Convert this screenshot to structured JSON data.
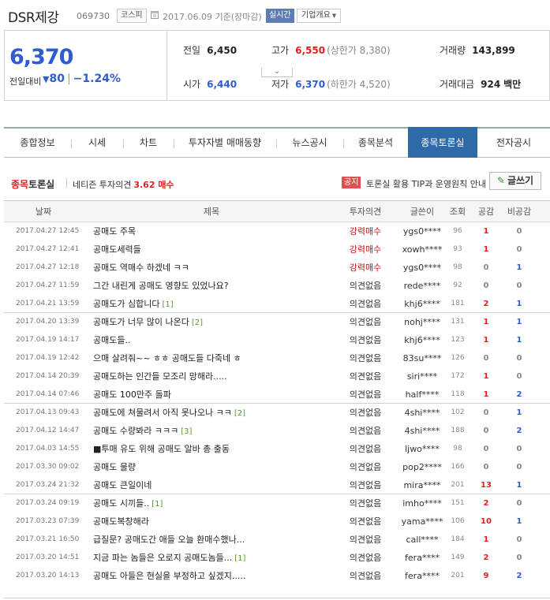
{
  "header": {
    "name": "DSR제강",
    "code": "069730",
    "market": "코스피",
    "date": "2017.06.09 기준(장마감)",
    "realtime": "실시간",
    "company_info": "기업개요"
  },
  "price": {
    "current": "6,370",
    "change_label": "전일대비",
    "change": "80",
    "change_pct": "−1.24%",
    "prev_close_label": "전일",
    "prev_close": "6,450",
    "high_label": "고가",
    "high": "6,550",
    "upper_limit": "(상한가 8,380)",
    "volume_label": "거래량",
    "volume": "143,899",
    "open_label": "시가",
    "open": "6,440",
    "low_label": "저가",
    "low": "6,370",
    "lower_limit": "(하한가 4,520)",
    "amount_label": "거래대금",
    "amount": "924",
    "amount_unit": "백만"
  },
  "tabs": [
    {
      "label": "종합정보"
    },
    {
      "label": "시세"
    },
    {
      "label": "차트"
    },
    {
      "label": "투자자별 매매동향"
    },
    {
      "label": "뉴스공시"
    },
    {
      "label": "종목분석"
    },
    {
      "label": "종목토론실",
      "active": true
    },
    {
      "label": "전자공시"
    }
  ],
  "board": {
    "title_red": "종목",
    "title_rest": "토론실",
    "opinion_label": "네티즌 투자의견",
    "opinion_value": "3.62 매수",
    "notice_badge": "공지",
    "notice_text": "토론실 활용 TIP과 운영원칙 안내",
    "write_button": "글쓰기",
    "columns": [
      "날짜",
      "제목",
      "투자의견",
      "글쓴이",
      "조회",
      "공감",
      "비공감"
    ]
  },
  "posts": [
    {
      "date": "2017.04.27 12:45",
      "title": "공매도 주목",
      "comments": "",
      "opinion": "강력매수",
      "writer": "ygs0****",
      "views": "96",
      "good": "1",
      "bad": "0"
    },
    {
      "date": "2017.04.27 12:41",
      "title": "공매도세력들",
      "comments": "",
      "opinion": "강력매수",
      "writer": "xowh****",
      "views": "93",
      "good": "1",
      "bad": "0"
    },
    {
      "date": "2017.04.27 12:18",
      "title": "공매도 역매수 하겠네 ㅋㅋ",
      "comments": "",
      "opinion": "강력매수",
      "writer": "ygs0****",
      "views": "98",
      "good": "0",
      "bad": "1"
    },
    {
      "date": "2017.04.27 11:59",
      "title": "그간 내린게 공매도 영향도 있었나요?",
      "comments": "",
      "opinion": "의견없음",
      "writer": "rede****",
      "views": "92",
      "good": "0",
      "bad": "0"
    },
    {
      "date": "2017.04.21 13:59",
      "title": "공매도가 심합니다",
      "comments": "[1]",
      "opinion": "의견없음",
      "writer": "khj6****",
      "views": "181",
      "good": "2",
      "bad": "1"
    },
    {
      "date": "2017.04.20 13:39",
      "title": "공매도가 너무 많이 나온다",
      "comments": "[2]",
      "opinion": "의견없음",
      "writer": "nohj****",
      "views": "131",
      "good": "1",
      "bad": "1"
    },
    {
      "date": "2017.04.19 14:17",
      "title": "공매도들..",
      "comments": "",
      "opinion": "의견없음",
      "writer": "khj6****",
      "views": "123",
      "good": "1",
      "bad": "1"
    },
    {
      "date": "2017.04.19 12:42",
      "title": "으매 살려줘~~ ㅎㅎ 공매도들 다죽네 ㅎ",
      "comments": "",
      "opinion": "의견없음",
      "writer": "83su****",
      "views": "126",
      "good": "0",
      "bad": "0"
    },
    {
      "date": "2017.04.14 20:39",
      "title": "공매도하는 인간들 모조리 망해라.....",
      "comments": "",
      "opinion": "의견없음",
      "writer": "siri****",
      "views": "172",
      "good": "1",
      "bad": "0"
    },
    {
      "date": "2017.04.14 07:46",
      "title": "공매도 100만주 돌파",
      "comments": "",
      "opinion": "의견없음",
      "writer": "half****",
      "views": "118",
      "good": "1",
      "bad": "2"
    },
    {
      "date": "2017.04.13 09:43",
      "title": "공매도에 쳐물려서 아직 못나오나 ㅋㅋ",
      "comments": "[2]",
      "opinion": "의견없음",
      "writer": "4shi****",
      "views": "102",
      "good": "0",
      "bad": "1"
    },
    {
      "date": "2017.04.12 14:47",
      "title": "공매도 수량봐라 ㅋㅋㅋ",
      "comments": "[3]",
      "opinion": "의견없음",
      "writer": "4shi****",
      "views": "188",
      "good": "0",
      "bad": "2"
    },
    {
      "date": "2017.04.03 14:55",
      "title": "■투매 유도 위해 공매도 알바 총 출동",
      "comments": "",
      "opinion": "의견없음",
      "writer": "ljwo****",
      "views": "98",
      "good": "0",
      "bad": "0"
    },
    {
      "date": "2017.03.30 09:02",
      "title": "공매도 물량",
      "comments": "",
      "opinion": "의견없음",
      "writer": "pop2****",
      "views": "166",
      "good": "0",
      "bad": "0"
    },
    {
      "date": "2017.03.24 21:32",
      "title": "공매도 큰일이네",
      "comments": "",
      "opinion": "의견없음",
      "writer": "mira****",
      "views": "201",
      "good": "13",
      "bad": "1"
    },
    {
      "date": "2017.03.24 09:19",
      "title": "공매도 시끼들..",
      "comments": "[1]",
      "opinion": "의견없음",
      "writer": "imho****",
      "views": "151",
      "good": "2",
      "bad": "0"
    },
    {
      "date": "2017.03.23 07:39",
      "title": "공매도복창해라",
      "comments": "",
      "opinion": "의견없음",
      "writer": "yama****",
      "views": "106",
      "good": "10",
      "bad": "1"
    },
    {
      "date": "2017.03.21 16:50",
      "title": "급질문? 공매도간 애들 오늘 환매수했나...",
      "comments": "",
      "opinion": "의견없음",
      "writer": "call****",
      "views": "184",
      "good": "1",
      "bad": "0"
    },
    {
      "date": "2017.03.20 14:51",
      "title": "지금 파는 놈들은 오로지 공매도놈들...",
      "comments": "[1]",
      "opinion": "의견없음",
      "writer": "fera****",
      "views": "149",
      "good": "2",
      "bad": "0"
    },
    {
      "date": "2017.03.20 14:13",
      "title": "공매도 아들은 현실을 부정하고 싶겠지.....",
      "comments": "",
      "opinion": "의견없음",
      "writer": "fera****",
      "views": "201",
      "good": "9",
      "bad": "2"
    }
  ]
}
